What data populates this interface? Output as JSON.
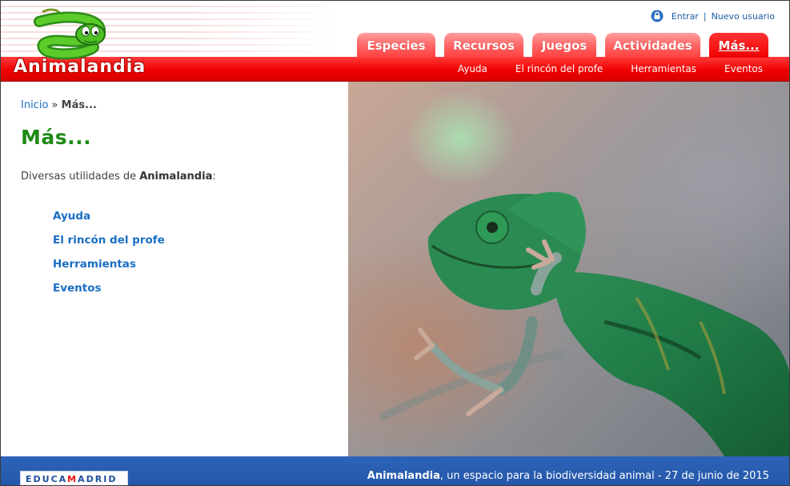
{
  "header": {
    "logo_text": "Animalandia",
    "user_links": {
      "login": "Entrar",
      "separator": "|",
      "register": "Nuevo usuario"
    },
    "tabs": [
      {
        "label": "Especies"
      },
      {
        "label": "Recursos"
      },
      {
        "label": "Juegos"
      },
      {
        "label": "Actividades"
      },
      {
        "label": "Más..."
      }
    ],
    "subnav": [
      "Ayuda",
      "El rincón del profe",
      "Herramientas",
      "Eventos"
    ]
  },
  "breadcrumb": {
    "home": "Inicio",
    "separator": "»",
    "current": "Más..."
  },
  "main": {
    "title": "Más...",
    "intro_prefix": "Diversas utilidades de ",
    "intro_strong": "Animalandia",
    "intro_suffix": ":",
    "items": [
      "Ayuda",
      "El rincón del profe",
      "Herramientas",
      "Eventos"
    ]
  },
  "footer": {
    "logo_text_1": "EDUCA",
    "logo_text_2": "M",
    "logo_text_3": "ADRID",
    "site_name": "Animalandia",
    "tagline": ", un espacio para la biodiversidad animal - 27 de junio de 2015"
  },
  "colors": {
    "header_red": "#f00000",
    "tab_pink": "#ff6b6b",
    "title_green": "#1e8a14",
    "link_blue": "#1a6fc4",
    "footer_blue": "#2457a8"
  }
}
